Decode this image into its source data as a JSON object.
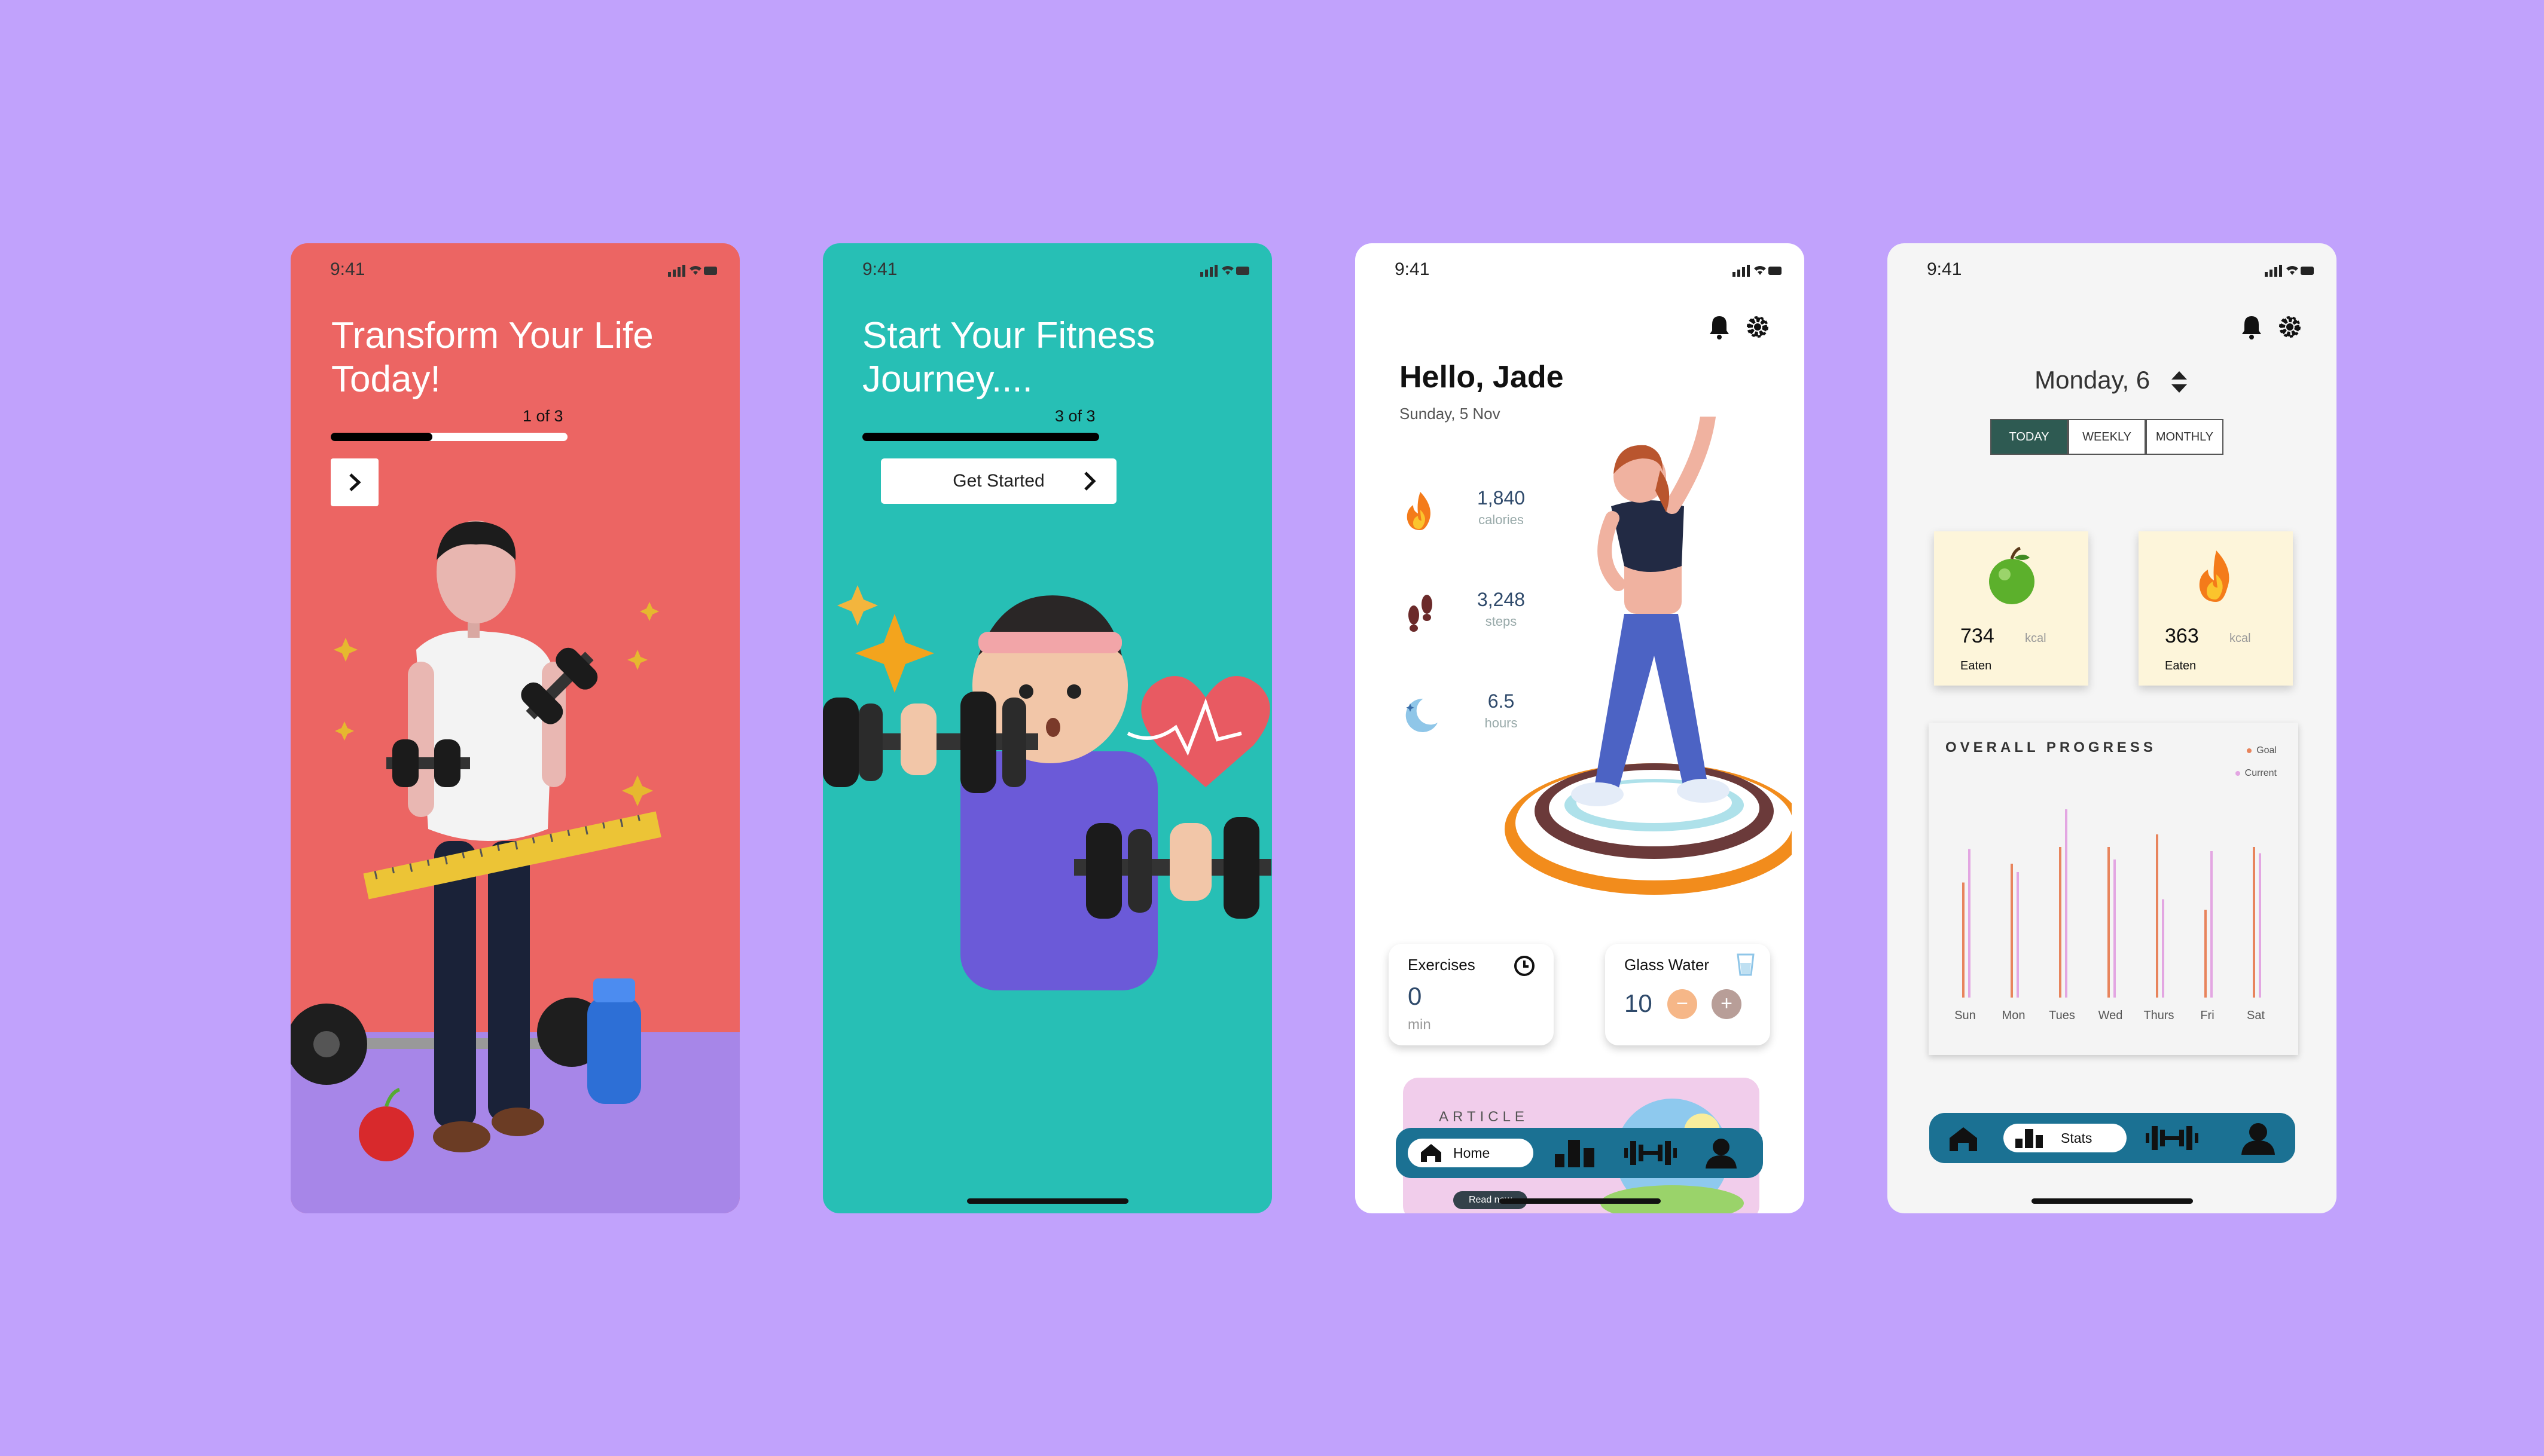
{
  "status_time": "9:41",
  "screen1": {
    "title": "Transform Your Life Today!",
    "progress_label": "1 of 3",
    "progress": 0.43
  },
  "screen2": {
    "title": "Start Your Fitness Journey....",
    "progress_label": "3 of 3",
    "progress": 1.0,
    "button": "Get Started"
  },
  "screen3": {
    "greeting": "Hello, Jade",
    "date": "Sunday, 5 Nov",
    "stats": [
      {
        "value": "1,840",
        "unit": "calories",
        "icon": "fire-icon"
      },
      {
        "value": "3,248",
        "unit": "steps",
        "icon": "footprints-icon"
      },
      {
        "value": "6.5",
        "unit": "hours",
        "icon": "moon-icon"
      }
    ],
    "exercises": {
      "label": "Exercises",
      "value": "0",
      "unit": "min"
    },
    "water": {
      "label": "Glass Water",
      "value": "10"
    },
    "article": {
      "label": "ARTICLE",
      "read": "Read now"
    },
    "nav": {
      "active": "Home"
    }
  },
  "screen4": {
    "day": "Monday, 6",
    "tabs": [
      "TODAY",
      "WEEKLY",
      "MONTHLY"
    ],
    "active_tab": "TODAY",
    "eaten": {
      "value": "734",
      "unit": "kcal",
      "label": "Eaten"
    },
    "burned": {
      "value": "363",
      "unit": "kcal",
      "label": "Eaten"
    },
    "nav": {
      "active": "Stats"
    }
  },
  "chart_data": {
    "type": "bar",
    "title": "OVERALL PROGRESS",
    "categories": [
      "Sun",
      "Mon",
      "Tues",
      "Wed",
      "Thurs",
      "Fri",
      "Sat"
    ],
    "series": [
      {
        "name": "Goal",
        "color": "#e8845c",
        "values": [
          55,
          64,
          72,
          72,
          78,
          42,
          72
        ]
      },
      {
        "name": "Current",
        "color": "#e3a6e2",
        "values": [
          71,
          60,
          90,
          66,
          47,
          70,
          69
        ]
      }
    ],
    "ylim": [
      0,
      100
    ]
  },
  "colors": {
    "background": "#c1a2fc",
    "screen1_bg": "#ec6563",
    "screen2_bg": "#27bfb5",
    "nav_bg": "#1b7193",
    "tab_active": "#2e5a52"
  }
}
